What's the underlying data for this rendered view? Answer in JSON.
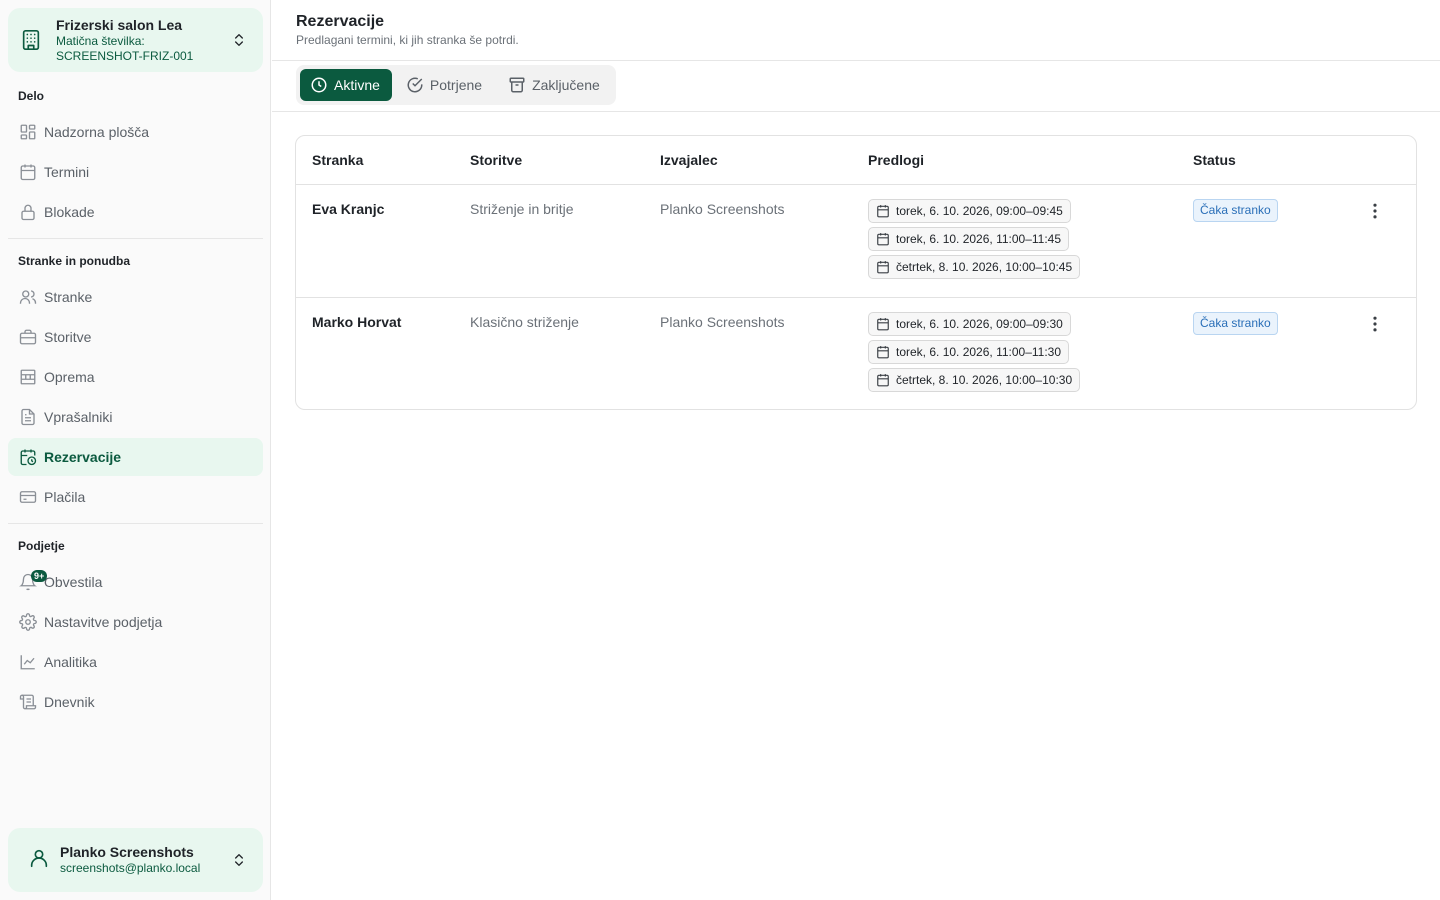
{
  "organization": {
    "name": "Frizerski salon Lea",
    "reg_label": "Matična številka:",
    "reg_value": "SCREENSHOT-FRIZ-001"
  },
  "sidebar": {
    "sections": [
      {
        "title": "Delo"
      },
      {
        "title": "Stranke in ponudba"
      },
      {
        "title": "Podjetje"
      }
    ],
    "items": [
      {
        "label": "Nadzorna plošča",
        "icon": "dashboard-icon"
      },
      {
        "label": "Termini",
        "icon": "calendar-icon"
      },
      {
        "label": "Blokade",
        "icon": "lock-icon"
      },
      {
        "label": "Stranke",
        "icon": "users-icon"
      },
      {
        "label": "Storitve",
        "icon": "briefcase-icon"
      },
      {
        "label": "Oprema",
        "icon": "equipment-icon"
      },
      {
        "label": "Vprašalniki",
        "icon": "document-icon"
      },
      {
        "label": "Rezervacije",
        "icon": "calendar-clock-icon",
        "active": true
      },
      {
        "label": "Plačila",
        "icon": "credit-card-icon"
      },
      {
        "label": "Obvestila",
        "icon": "bell-icon",
        "badge": "9+"
      },
      {
        "label": "Nastavitve podjetja",
        "icon": "gear-icon"
      },
      {
        "label": "Analitika",
        "icon": "chart-icon"
      },
      {
        "label": "Dnevnik",
        "icon": "scroll-icon"
      }
    ]
  },
  "user": {
    "name": "Planko Screenshots",
    "email": "screenshots@planko.local"
  },
  "page": {
    "title": "Rezervacije",
    "subtitle": "Predlagani termini, ki jih stranka še potrdi."
  },
  "tabs": [
    {
      "label": "Aktivne",
      "active": true
    },
    {
      "label": "Potrjene"
    },
    {
      "label": "Zaključene"
    }
  ],
  "table": {
    "headers": [
      "Stranka",
      "Storitve",
      "Izvajalec",
      "Predlogi",
      "Status"
    ],
    "rows": [
      {
        "client": "Eva Kranjc",
        "service": "Striženje in britje",
        "provider": "Planko Screenshots",
        "slots": [
          "torek, 6. 10. 2026, 09:00–09:45",
          "torek, 6. 10. 2026, 11:00–11:45",
          "četrtek, 8. 10. 2026, 10:00–10:45"
        ],
        "status": "Čaka stranko"
      },
      {
        "client": "Marko Horvat",
        "service": "Klasično striženje",
        "provider": "Planko Screenshots",
        "slots": [
          "torek, 6. 10. 2026, 09:00–09:30",
          "torek, 6. 10. 2026, 11:00–11:30",
          "četrtek, 8. 10. 2026, 10:00–10:30"
        ],
        "status": "Čaka stranko"
      }
    ]
  },
  "colors": {
    "accent": "#0b5a3f",
    "accent_light": "#e8f7ef",
    "status_blue": "#2a6fb8"
  }
}
